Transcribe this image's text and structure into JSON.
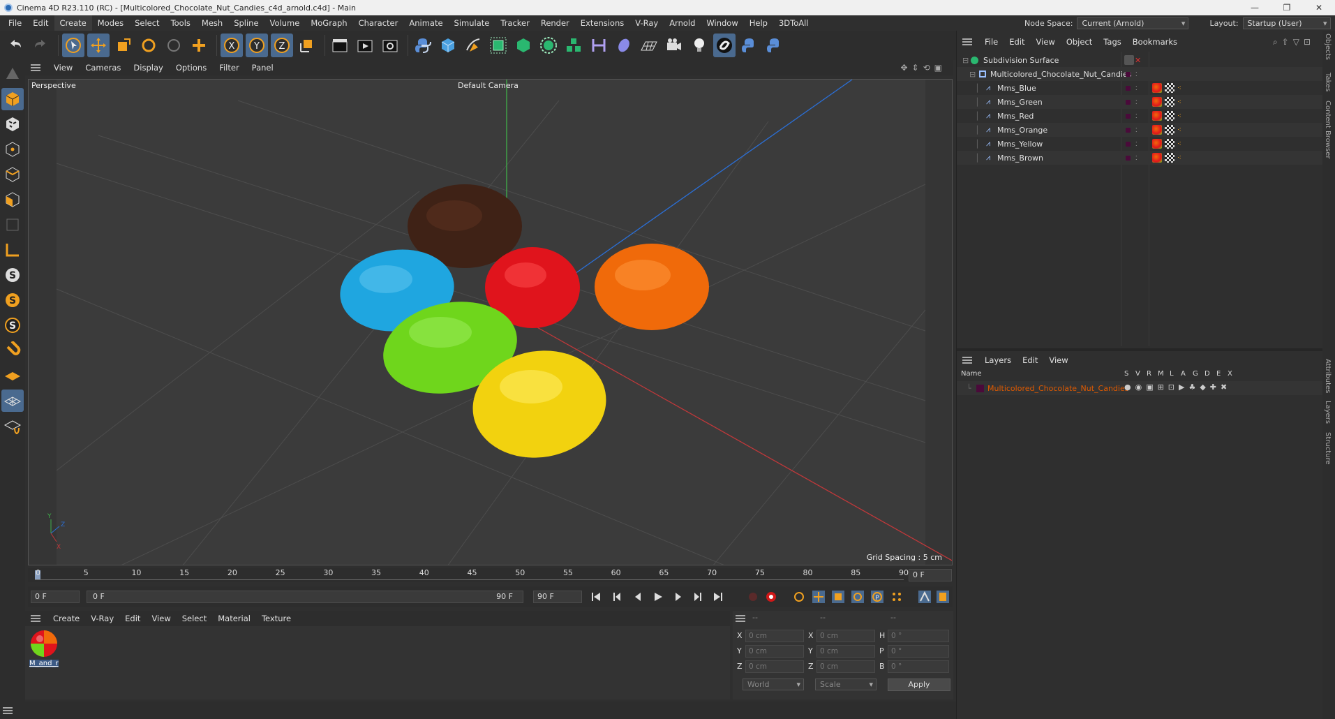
{
  "window": {
    "title": "Cinema 4D R23.110 (RC) - [Multicolored_Chocolate_Nut_Candies_c4d_arnold.c4d] - Main",
    "controls": [
      "—",
      "❐",
      "✕"
    ]
  },
  "menubar": {
    "items": [
      "File",
      "Edit",
      "Create",
      "Modes",
      "Select",
      "Tools",
      "Mesh",
      "Spline",
      "Volume",
      "MoGraph",
      "Character",
      "Animate",
      "Simulate",
      "Tracker",
      "Render",
      "Extensions",
      "V-Ray",
      "Arnold",
      "Window",
      "Help",
      "3DToAll"
    ],
    "node_space_label": "Node Space:",
    "node_space_value": "Current (Arnold)",
    "layout_label": "Layout:",
    "layout_value": "Startup (User)"
  },
  "viewport": {
    "menu": [
      "View",
      "Cameras",
      "Display",
      "Options",
      "Filter",
      "Panel"
    ],
    "label": "Perspective",
    "camera": "Default Camera",
    "grid_spacing": "Grid Spacing : 5 cm",
    "axis_y": "Y",
    "axis_z": "Z",
    "axis_x": "X"
  },
  "timeline": {
    "ticks": [
      "0",
      "5",
      "10",
      "15",
      "20",
      "25",
      "30",
      "35",
      "40",
      "45",
      "50",
      "55",
      "60",
      "65",
      "70",
      "75",
      "80",
      "85",
      "90"
    ],
    "current_frame_display": "0 F",
    "start_field": "0 F",
    "range_start": "0 F",
    "range_end": "90 F",
    "end_field": "90 F"
  },
  "material_manager": {
    "menu": [
      "Create",
      "V-Ray",
      "Edit",
      "View",
      "Select",
      "Material",
      "Texture"
    ],
    "material_name": "M_and_r"
  },
  "attributes": {
    "headers": [
      "--",
      "--",
      "--"
    ],
    "rows": [
      {
        "l1": "X",
        "v1": "0 cm",
        "l2": "X",
        "v2": "0 cm",
        "l3": "H",
        "v3": "0 °"
      },
      {
        "l1": "Y",
        "v1": "0 cm",
        "l2": "Y",
        "v2": "0 cm",
        "l3": "P",
        "v3": "0 °"
      },
      {
        "l1": "Z",
        "v1": "0 cm",
        "l2": "Z",
        "v2": "0 cm",
        "l3": "B",
        "v3": "0 °"
      }
    ],
    "coord_mode": "World",
    "scale_mode": "Scale",
    "apply_label": "Apply"
  },
  "object_manager": {
    "menu": [
      "File",
      "Edit",
      "View",
      "Object",
      "Tags",
      "Bookmarks"
    ],
    "objects": [
      {
        "name": "Subdivision Surface",
        "indent": 0
      },
      {
        "name": "Multicolored_Chocolate_Nut_Candies",
        "indent": 1
      },
      {
        "name": "Mms_Blue",
        "indent": 2
      },
      {
        "name": "Mms_Green",
        "indent": 2
      },
      {
        "name": "Mms_Red",
        "indent": 2
      },
      {
        "name": "Mms_Orange",
        "indent": 2
      },
      {
        "name": "Mms_Yellow",
        "indent": 2
      },
      {
        "name": "Mms_Brown",
        "indent": 2
      }
    ]
  },
  "layer_manager": {
    "menu": [
      "Layers",
      "Edit",
      "View"
    ],
    "name_header": "Name",
    "columns": [
      "S",
      "V",
      "R",
      "M",
      "L",
      "A",
      "G",
      "D",
      "E",
      "X"
    ],
    "layer_name": "Multicolored_Chocolate_Nut_Candies",
    "layer_color": "#e05a00"
  },
  "side_tabs": [
    "Objects",
    "Takes",
    "Content Browser",
    "Attributes",
    "Layers",
    "Structure"
  ],
  "colors": {
    "accent": "#4a6a8f",
    "blue_candy": "#1fa6e0",
    "green_candy": "#6fd61c",
    "red_candy": "#e0141c",
    "orange_candy": "#f06a0a",
    "yellow_candy": "#f2d20f",
    "brown_candy": "#3f2216"
  }
}
